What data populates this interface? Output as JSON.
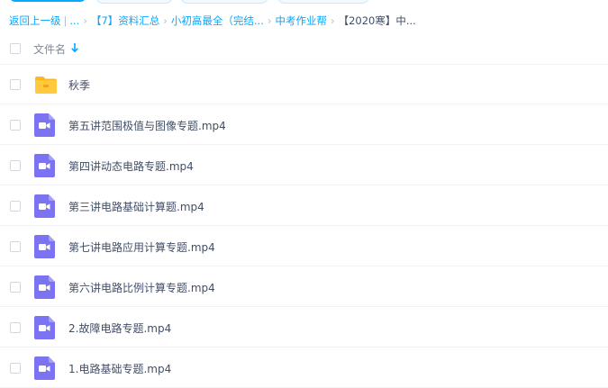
{
  "breadcrumb": {
    "back": "返回上一级",
    "divider": "|",
    "ellipsis": "...",
    "items": [
      "【7】资料汇总",
      "小初高最全（完结...",
      "中考作业帮"
    ],
    "current": "【2020寒】中..."
  },
  "list_header": {
    "name_label": "文件名"
  },
  "files": [
    {
      "name": "秋季",
      "type": "folder"
    },
    {
      "name": "第五讲范围极值与图像专题.mp4",
      "type": "video"
    },
    {
      "name": "第四讲动态电路专题.mp4",
      "type": "video"
    },
    {
      "name": "第三讲电路基础计算题.mp4",
      "type": "video"
    },
    {
      "name": "第七讲电路应用计算专题.mp4",
      "type": "video"
    },
    {
      "name": "第六讲电路比例计算专题.mp4",
      "type": "video"
    },
    {
      "name": "2.故障电路专题.mp4",
      "type": "video"
    },
    {
      "name": "1.电路基础专题.mp4",
      "type": "video"
    }
  ],
  "colors": {
    "accent": "#06a7ff",
    "video_icon": "#7b73f2",
    "folder_icon": "#ffca3e"
  },
  "icons": {
    "sort": "arrow-down-icon",
    "folder": "folder-icon",
    "video": "video-file-icon"
  }
}
